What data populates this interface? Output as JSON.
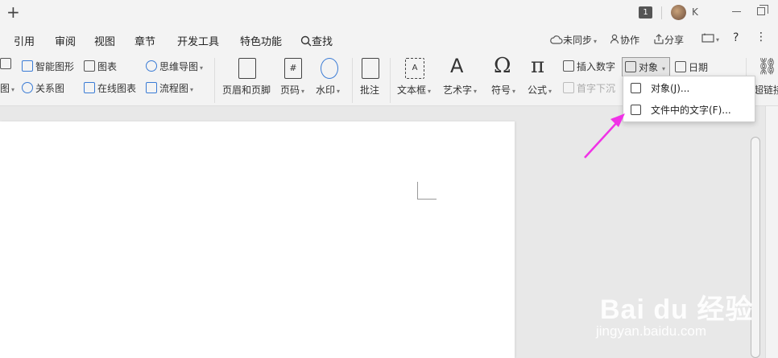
{
  "titlebar": {
    "plus": "+",
    "badge": "1",
    "user_initial": "K"
  },
  "menu": {
    "items": [
      "引用",
      "审阅",
      "视图",
      "章节",
      "开发工具",
      "特色功能",
      "查找"
    ],
    "right": {
      "sync": "未同步",
      "collab": "协作",
      "share": "分享",
      "help": "?"
    }
  },
  "ribbon": {
    "left_col1": [
      "图",
      "智能图形",
      "关系图"
    ],
    "chart": "图表",
    "online_chart": "在线图表",
    "mindmap": "思维导图",
    "flowchart": "流程图",
    "header_footer": "页眉和页脚",
    "page_number": "页码",
    "watermark": "水印",
    "comment": "批注",
    "textbox": "文本框",
    "wordart": "艺术字",
    "symbol": "符号",
    "formula": "公式",
    "insert_number": "插入数字",
    "drop_cap": "首字下沉",
    "object": "对象",
    "date": "日期",
    "hyperlink": "超链接"
  },
  "dropdown": {
    "items": [
      {
        "label": "对象(J)..."
      },
      {
        "label": "文件中的文字(F)..."
      }
    ]
  },
  "watermark": {
    "brand": "Bai du 经验",
    "url": "jingyan.baidu.com"
  },
  "colors": {
    "accent": "#3a7bd5",
    "arrow": "#f032e6",
    "ribbon_bg": "#f3f3f3"
  }
}
